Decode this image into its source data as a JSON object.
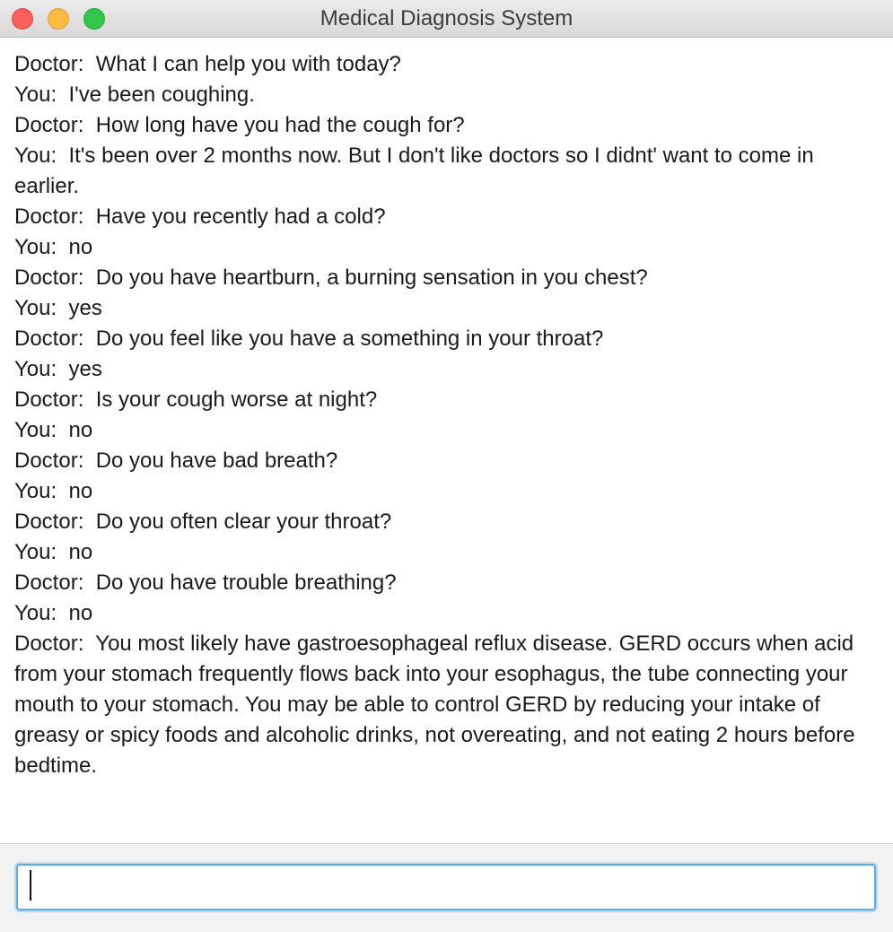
{
  "window": {
    "title": "Medical Diagnosis System"
  },
  "transcript": [
    {
      "speaker": "Doctor",
      "text": "Doctor:  What I can help you with today?"
    },
    {
      "speaker": "You",
      "text": "You:  I've been coughing."
    },
    {
      "speaker": "Doctor",
      "text": "Doctor:  How long have you had the cough for?"
    },
    {
      "speaker": "You",
      "text": "You:  It's been over 2 months now. But I don't like doctors so I didnt' want to come in earlier."
    },
    {
      "speaker": "Doctor",
      "text": "Doctor:  Have you recently had a cold?"
    },
    {
      "speaker": "You",
      "text": "You:  no"
    },
    {
      "speaker": "Doctor",
      "text": "Doctor:  Do you have heartburn, a burning sensation in you chest?"
    },
    {
      "speaker": "You",
      "text": "You:  yes"
    },
    {
      "speaker": "Doctor",
      "text": "Doctor:  Do you feel like you have a something in your throat?"
    },
    {
      "speaker": "You",
      "text": "You:  yes"
    },
    {
      "speaker": "Doctor",
      "text": "Doctor:  Is your cough worse at night?"
    },
    {
      "speaker": "You",
      "text": "You:  no"
    },
    {
      "speaker": "Doctor",
      "text": "Doctor:  Do you have bad breath?"
    },
    {
      "speaker": "You",
      "text": "You:  no"
    },
    {
      "speaker": "Doctor",
      "text": "Doctor:  Do you often clear your throat?"
    },
    {
      "speaker": "You",
      "text": "You:  no"
    },
    {
      "speaker": "Doctor",
      "text": "Doctor:  Do you have trouble breathing?"
    },
    {
      "speaker": "You",
      "text": "You:  no"
    },
    {
      "speaker": "Doctor",
      "text": "Doctor:  You most likely have gastroesophageal reflux disease. GERD occurs when acid from your stomach frequently flows back into your esophagus, the tube connecting your mouth to your stomach. You may be able to control GERD by reducing your intake of greasy or spicy foods and alcoholic drinks, not overeating, and not eating 2 hours before bedtime."
    }
  ],
  "input": {
    "value": "",
    "placeholder": ""
  },
  "colors": {
    "focus_ring": "#5ea9e8",
    "close": "#fc605c",
    "minimize": "#fdbc40",
    "zoom": "#34c84a"
  }
}
